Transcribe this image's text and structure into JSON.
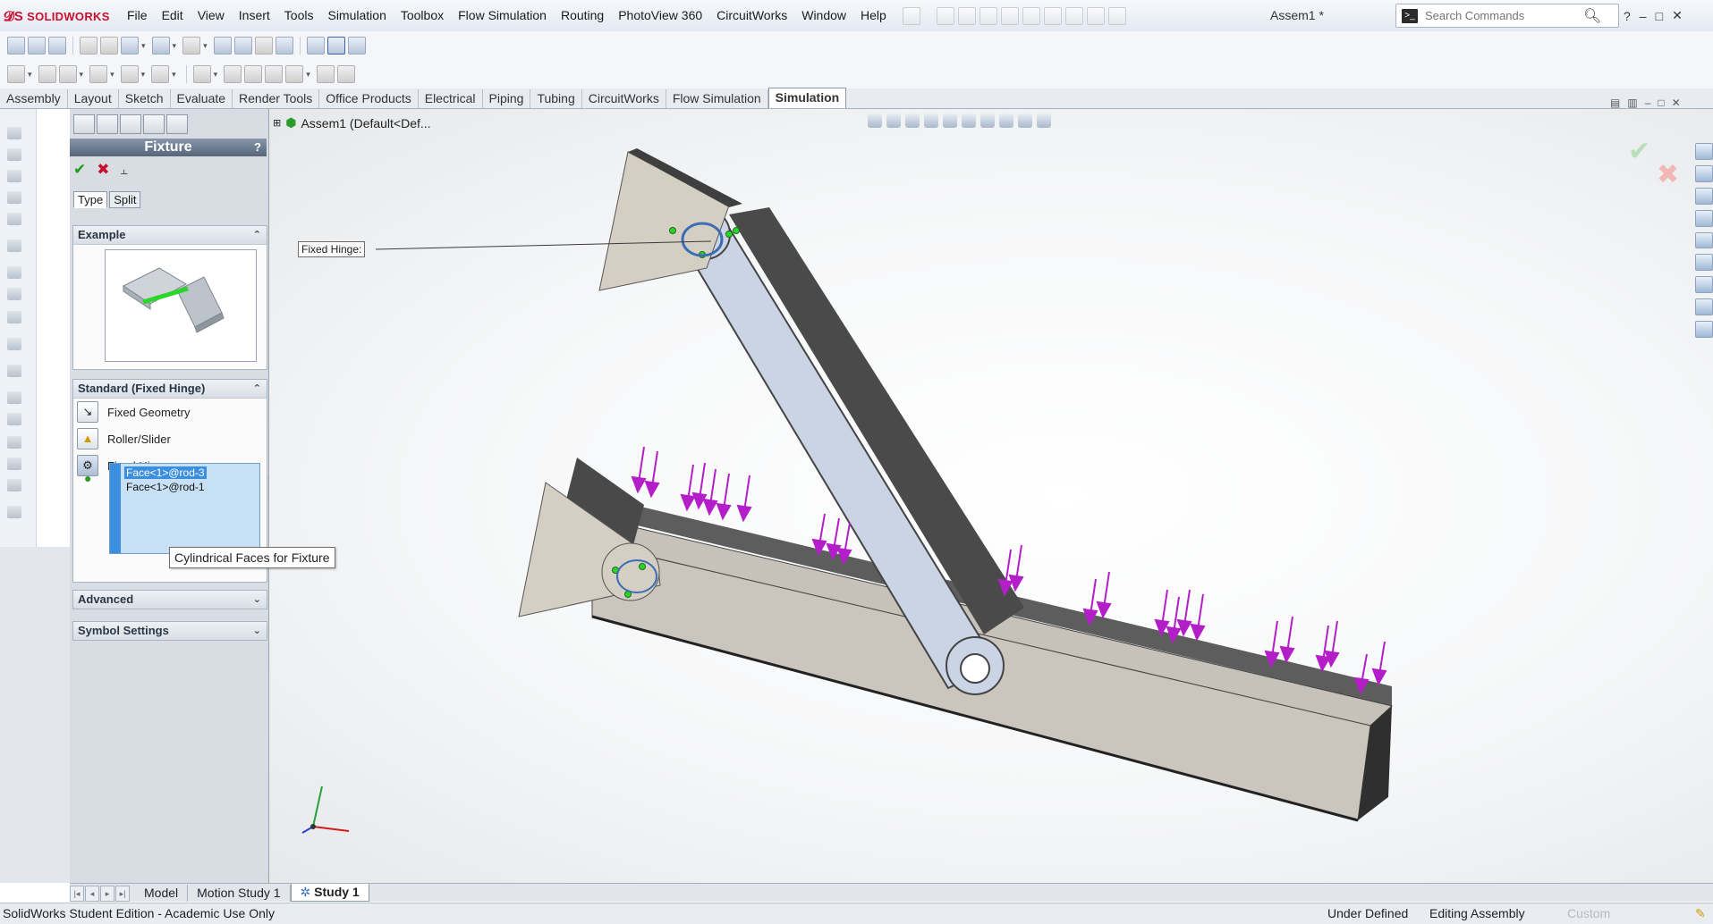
{
  "app": {
    "logo": "SOLIDWORKS",
    "document_title": "Assem1 *"
  },
  "menu": [
    "File",
    "Edit",
    "View",
    "Insert",
    "Tools",
    "Simulation",
    "Toolbox",
    "Flow Simulation",
    "Routing",
    "PhotoView 360",
    "CircuitWorks",
    "Window",
    "Help"
  ],
  "search": {
    "placeholder": "Search Commands"
  },
  "command_tabs": [
    "Assembly",
    "Layout",
    "Sketch",
    "Evaluate",
    "Render Tools",
    "Office Products",
    "Electrical",
    "Piping",
    "Tubing",
    "CircuitWorks",
    "Flow Simulation",
    "Simulation"
  ],
  "active_command_tab": "Simulation",
  "property_manager": {
    "title": "Fixture",
    "help": "?",
    "tabs": {
      "type": "Type",
      "split": "Split"
    },
    "example": {
      "title": "Example"
    },
    "standard": {
      "title": "Standard (Fixed Hinge)",
      "options": {
        "fixed_geometry": "Fixed Geometry",
        "roller_slider": "Roller/Slider",
        "fixed_hinge": "Fixed Hinge"
      },
      "selected_faces": [
        "Face<1>@rod-3",
        "Face<1>@rod-1"
      ]
    },
    "advanced": {
      "title": "Advanced"
    },
    "symbol_settings": {
      "title": "Symbol Settings"
    }
  },
  "tooltip": "Cylindrical Faces for Fixture",
  "feature_tree": {
    "root": "Assem1  (Default<Def..."
  },
  "callout": {
    "label": "Fixed Hinge:"
  },
  "bottom_tabs": {
    "model": "Model",
    "motion_study": "Motion Study 1",
    "study": "Study 1"
  },
  "status": {
    "edition": "SolidWorks Student Edition - Academic Use Only",
    "definition": "Under Defined",
    "mode": "Editing Assembly",
    "units": "Custom"
  },
  "colors": {
    "load_arrow": "#b41ec8",
    "hinge_marker": "#2bd62b",
    "selection_blue": "#3c8fde",
    "arm": "#c9d2e3",
    "beam": "#cbc6bd"
  }
}
